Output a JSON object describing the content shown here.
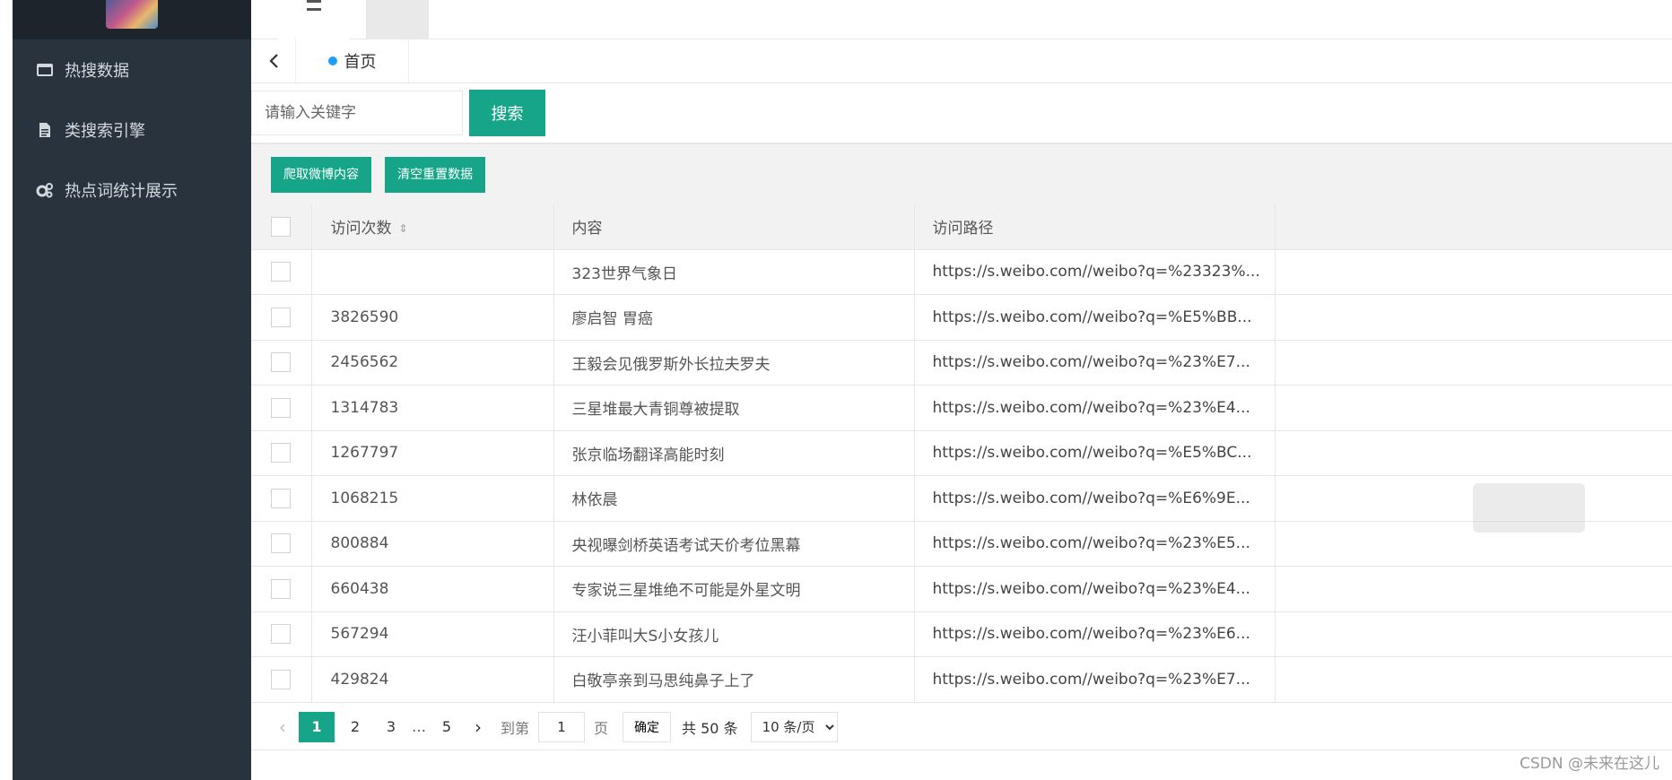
{
  "sidebar": {
    "items": [
      {
        "label": "热搜数据",
        "icon": "window-icon"
      },
      {
        "label": "类搜索引擎",
        "icon": "document-icon"
      },
      {
        "label": "热点词统计展示",
        "icon": "gears-icon"
      }
    ]
  },
  "tabs": {
    "home_label": "首页"
  },
  "search": {
    "placeholder": "请输入关键字",
    "button_label": "搜索"
  },
  "toolbar": {
    "crawl_label": "爬取微博内容",
    "clear_label": "清空重置数据"
  },
  "table": {
    "columns": [
      "访问次数",
      "内容",
      "访问路径"
    ],
    "rows": [
      {
        "count": "",
        "content": "323世界气象日",
        "url": "https://s.weibo.com//weibo?q=%23323%..."
      },
      {
        "count": "3826590",
        "content": "廖启智 胃癌",
        "url": "https://s.weibo.com//weibo?q=%E5%BB..."
      },
      {
        "count": "2456562",
        "content": "王毅会见俄罗斯外长拉夫罗夫",
        "url": "https://s.weibo.com//weibo?q=%23%E7..."
      },
      {
        "count": "1314783",
        "content": "三星堆最大青铜尊被提取",
        "url": "https://s.weibo.com//weibo?q=%23%E4..."
      },
      {
        "count": "1267797",
        "content": "张京临场翻译高能时刻",
        "url": "https://s.weibo.com//weibo?q=%E5%BC..."
      },
      {
        "count": "1068215",
        "content": "林依晨",
        "url": "https://s.weibo.com//weibo?q=%E6%9E..."
      },
      {
        "count": "800884",
        "content": "央视曝剑桥英语考试天价考位黑幕",
        "url": "https://s.weibo.com//weibo?q=%23%E5..."
      },
      {
        "count": "660438",
        "content": "专家说三星堆绝不可能是外星文明",
        "url": "https://s.weibo.com//weibo?q=%23%E4..."
      },
      {
        "count": "567294",
        "content": "汪小菲叫大S小女孩儿",
        "url": "https://s.weibo.com//weibo?q=%23%E6..."
      },
      {
        "count": "429824",
        "content": "白敬亭亲到马思纯鼻子上了",
        "url": "https://s.weibo.com//weibo?q=%23%E7..."
      }
    ]
  },
  "pagination": {
    "pages": [
      "1",
      "2",
      "3",
      "5"
    ],
    "ellipsis": "…",
    "goto_label": "到第",
    "goto_value": "1",
    "page_unit": "页",
    "confirm_label": "确定",
    "total_text": "共 50 条",
    "page_size": "10 条/页"
  },
  "watermark": "CSDN @未来在这儿"
}
